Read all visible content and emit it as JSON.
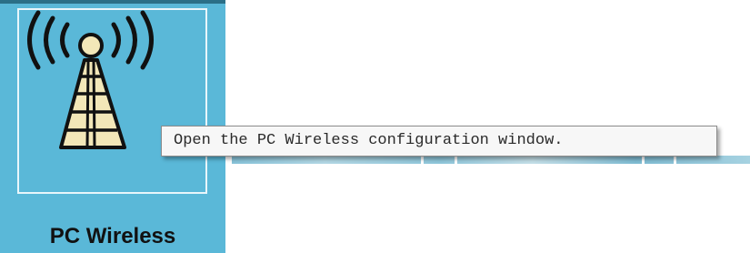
{
  "tile": {
    "label": "PC Wireless",
    "icon": "wireless-tower-icon",
    "background_color": "#5ab8d8"
  },
  "tooltip": {
    "text": "Open the PC Wireless configuration window."
  }
}
